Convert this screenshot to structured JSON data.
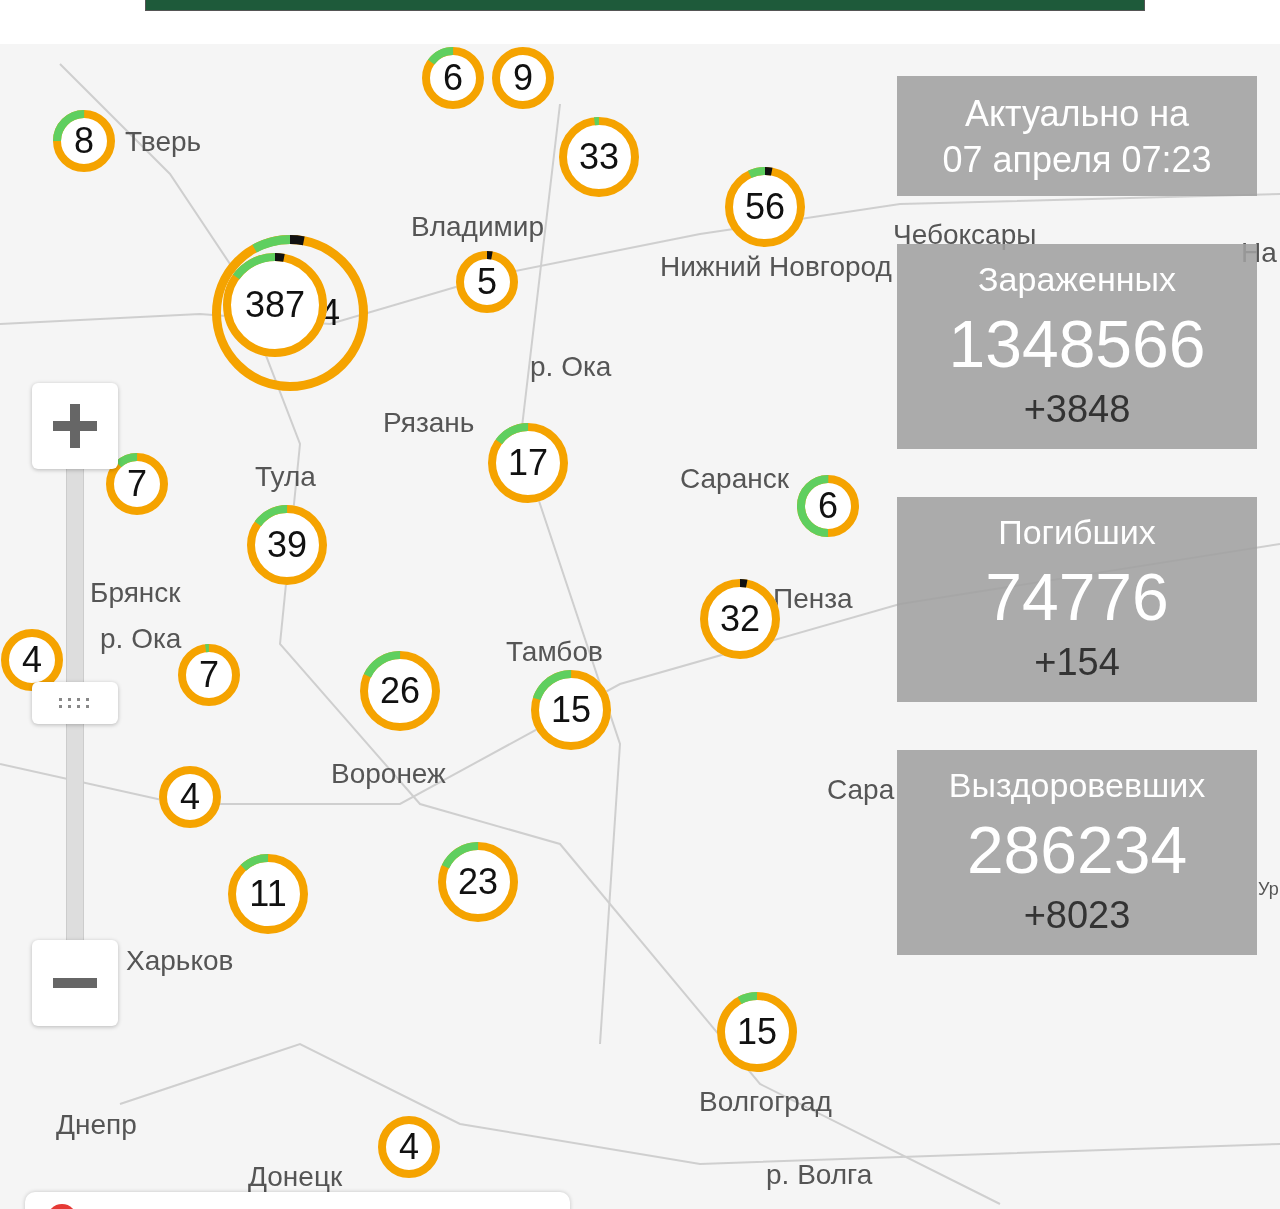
{
  "updated": {
    "label": "Актуально на",
    "datetime": "07 апреля 07:23"
  },
  "stats": [
    {
      "label": "Зараженных",
      "value": "1348566",
      "delta": "+3848"
    },
    {
      "label": "Погибших",
      "value": "74776",
      "delta": "+154"
    },
    {
      "label": "Выздоровевших",
      "value": "286234",
      "delta": "+8023"
    }
  ],
  "cities": [
    {
      "name": "Тверь"
    },
    {
      "name": "Владимир"
    },
    {
      "name": "Нижний Новгород"
    },
    {
      "name": "Чебоксары"
    },
    {
      "name": "На"
    },
    {
      "name": "Рязань"
    },
    {
      "name": "Тула"
    },
    {
      "name": "Саранск"
    },
    {
      "name": "Брянск"
    },
    {
      "name": "р. Ока"
    },
    {
      "name": "р. Ока"
    },
    {
      "name": "Пенза"
    },
    {
      "name": "Тамбов"
    },
    {
      "name": "Воронеж"
    },
    {
      "name": "Сара"
    },
    {
      "name": "Ур"
    },
    {
      "name": "Харьков"
    },
    {
      "name": "Днепр"
    },
    {
      "name": "Донецк"
    },
    {
      "name": "Волгоград"
    },
    {
      "name": "р. Волга"
    }
  ],
  "markers": [
    {
      "kind": "cluster",
      "count": "8",
      "level": 0.25,
      "deaths": false
    },
    {
      "kind": "cluster",
      "count": "6",
      "level": 0.15,
      "deaths": false
    },
    {
      "kind": "cluster",
      "count": "9",
      "level": 0,
      "deaths": false
    },
    {
      "kind": "cluster",
      "count": "33",
      "level": 0.02,
      "deaths": false
    },
    {
      "kind": "cluster",
      "count": "56",
      "level": 0.07,
      "deaths": true
    },
    {
      "kind": "group",
      "count": "4",
      "level": 0.08,
      "deaths": true
    },
    {
      "kind": "cluster",
      "count": "387",
      "level": 0.15,
      "deaths": true
    },
    {
      "kind": "cluster",
      "count": "5",
      "level": 0,
      "deaths": true
    },
    {
      "kind": "cluster",
      "count": "7",
      "level": 0.12,
      "deaths": false
    },
    {
      "kind": "cluster",
      "count": "39",
      "level": 0.15,
      "deaths": false
    },
    {
      "kind": "cluster",
      "count": "17",
      "level": 0.15,
      "deaths": false
    },
    {
      "kind": "cluster",
      "count": "6",
      "level": 0.5,
      "deaths": false
    },
    {
      "kind": "cluster",
      "count": "32",
      "level": 0,
      "deaths": true
    },
    {
      "kind": "cluster",
      "count": "7",
      "level": 0.02,
      "deaths": false
    },
    {
      "kind": "cluster",
      "count": "26",
      "level": 0.18,
      "deaths": false
    },
    {
      "kind": "cluster",
      "count": "15",
      "level": 0.2,
      "deaths": false
    },
    {
      "kind": "cluster",
      "count": "4",
      "level": 0,
      "deaths": false
    },
    {
      "kind": "cluster",
      "count": "11",
      "level": 0.12,
      "deaths": false
    },
    {
      "kind": "cluster",
      "count": "23",
      "level": 0.18,
      "deaths": false
    },
    {
      "kind": "cluster",
      "count": "15",
      "level": 0.08,
      "deaths": false
    },
    {
      "kind": "cluster",
      "count": "4",
      "level": 0,
      "deaths": false
    },
    {
      "kind": "cluster",
      "count": "4",
      "level": 0,
      "deaths": false
    }
  ]
}
